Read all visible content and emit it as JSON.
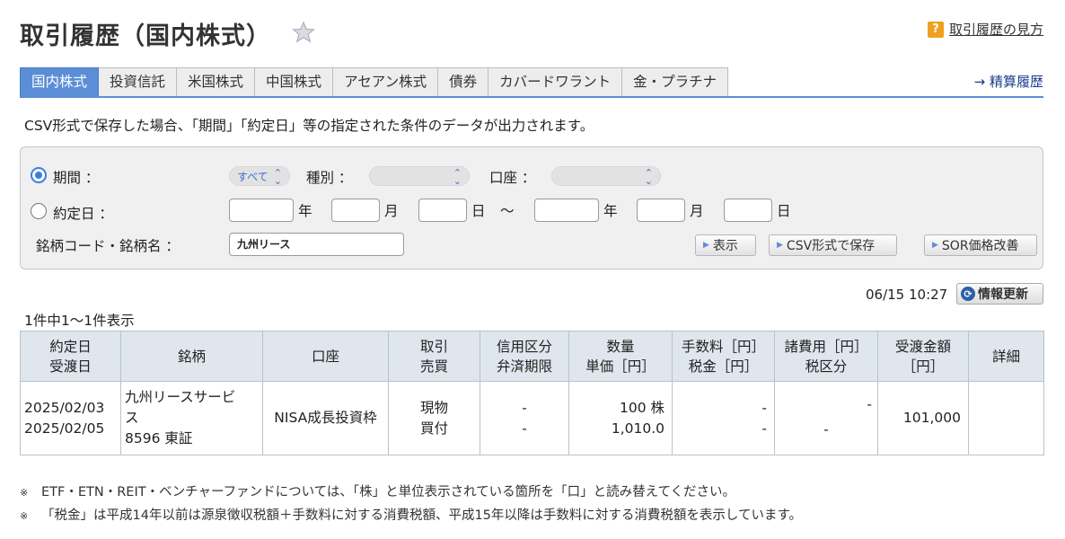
{
  "page": {
    "title": "取引履歴（国内株式）",
    "help_label": "取引履歴の見方",
    "help_badge": "?",
    "settlement_link": "→ 精算履歴"
  },
  "tabs": [
    {
      "label": "国内株式",
      "active": true
    },
    {
      "label": "投資信託",
      "active": false
    },
    {
      "label": "米国株式",
      "active": false
    },
    {
      "label": "中国株式",
      "active": false
    },
    {
      "label": "アセアン株式",
      "active": false
    },
    {
      "label": "債券",
      "active": false
    },
    {
      "label": "カバードワラント",
      "active": false
    },
    {
      "label": "金・プラチナ",
      "active": false
    }
  ],
  "notice": "CSV形式で保存した場合、「期間」「約定日」等の指定された条件のデータが出力されます。",
  "search": {
    "period_label": "期間 ：",
    "period_value": "すべて",
    "type_label": "種別 ：",
    "type_value": "",
    "account_label": "口座 ：",
    "account_value": "",
    "trade_date_label": "約定日 ：",
    "year": "年",
    "month": "月",
    "day": "日",
    "tilde": "〜",
    "symbol_label": "銘柄コード・銘柄名 ：",
    "symbol_value": "九州リース",
    "btn_show": "表示",
    "btn_csv": "CSV形式で保存",
    "btn_sor": "SOR価格改善"
  },
  "status": {
    "timestamp": "06/15 10:27",
    "refresh_label": "情報更新",
    "count_text": "1件中1〜1件表示"
  },
  "table": {
    "headers": [
      [
        "約定日",
        "受渡日"
      ],
      [
        "銘柄"
      ],
      [
        "口座"
      ],
      [
        "取引",
        "売買"
      ],
      [
        "信用区分",
        "弁済期限"
      ],
      [
        "数量",
        "単価［円］"
      ],
      [
        "手数料［円］",
        "税金［円］"
      ],
      [
        "諸費用［円］",
        "税区分"
      ],
      [
        "受渡金額",
        "［円］"
      ],
      [
        "詳細"
      ]
    ],
    "rows": [
      {
        "trade_date": "2025/02/03",
        "settle_date": "2025/02/05",
        "name": "九州リースサービス",
        "code_market": "8596 東証",
        "account": "NISA成長投資枠",
        "trade": "現物",
        "side": "買付",
        "margin_type": "-",
        "due_date": "-",
        "quantity": "100 株",
        "price": "1,010.0",
        "fee": "-",
        "tax": "-",
        "expenses": "-",
        "tax_class": "-",
        "amount": "101,000",
        "detail": ""
      }
    ]
  },
  "notes": [
    {
      "mark": "※",
      "text": "ETF・ETN・REIT・ベンチャーファンドについては、「株」と単位表示されている箇所を「口」と読み替えてください。"
    },
    {
      "mark": "※",
      "text": "「税金」は平成14年以前は源泉徴収税額＋手数料に対する消費税額、平成15年以降は手数料に対する消費税額を表示しています。"
    }
  ],
  "colors": {
    "tab_active": "#5b8ed6",
    "link": "#1a3d8f",
    "header_bg": "#dfe6ee",
    "radio_on": "#3b7de0"
  }
}
